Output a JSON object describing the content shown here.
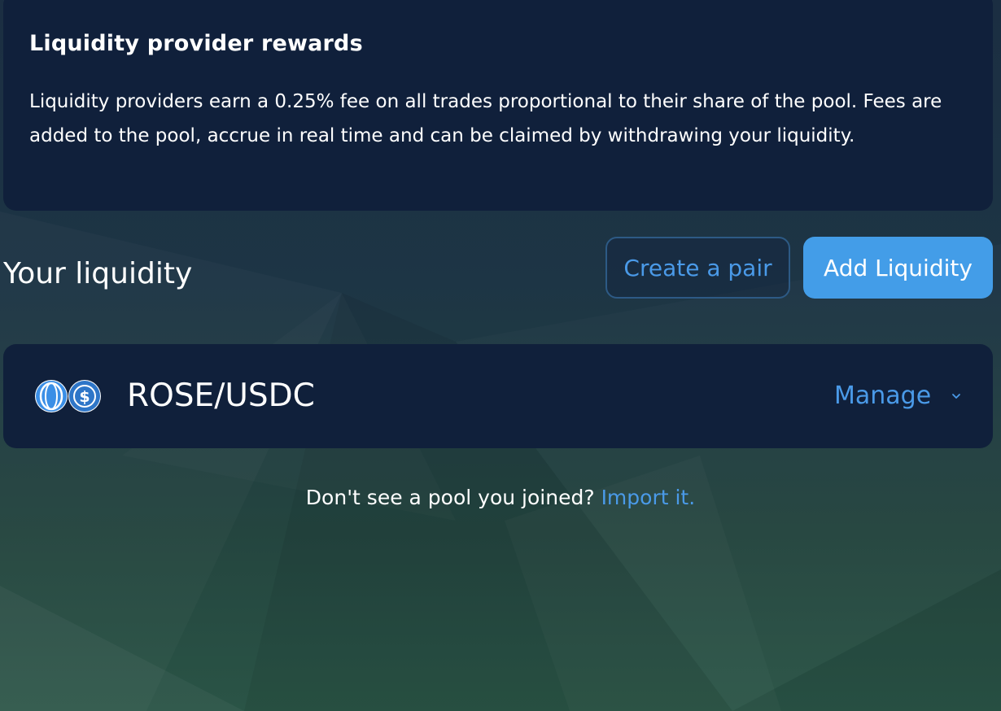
{
  "rewards": {
    "title": "Liquidity provider rewards",
    "body": "Liquidity providers earn a 0.25% fee on all trades proportional to their share of the pool. Fees are added to the pool, accrue in real time and can be claimed by withdrawing your liquidity."
  },
  "liquidity": {
    "title": "Your liquidity",
    "create_pair_label": "Create a pair",
    "add_liquidity_label": "Add Liquidity"
  },
  "pool": {
    "pair": "ROSE/USDC",
    "token_icons": [
      "rose-token-icon",
      "usdc-token-icon"
    ],
    "manage_label": "Manage"
  },
  "footer": {
    "prompt": "Don't see a pool you joined?",
    "link_label": "Import it."
  },
  "colors": {
    "card_bg": "#10203b",
    "accent": "#439de8",
    "link": "#4a9ae8"
  }
}
